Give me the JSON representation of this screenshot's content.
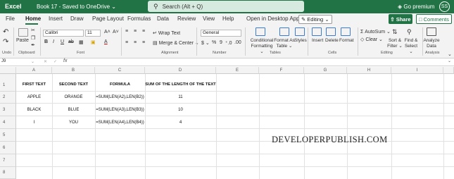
{
  "title": {
    "app": "Excel",
    "document": "Book 17 - Saved to OneDrive ⌄",
    "search_placeholder": "Search (Alt + Q)",
    "premium": "Go premium",
    "avatar_initials": "SS"
  },
  "menu": {
    "tabs": [
      "File",
      "Home",
      "Insert",
      "Draw",
      "Page Layout",
      "Formulas",
      "Data",
      "Review",
      "View",
      "Help",
      "Open in Desktop App"
    ],
    "editing": "Editing ⌄",
    "share": "Share",
    "comments": "Comments"
  },
  "ribbon": {
    "undo": "Undo",
    "paste": "Paste",
    "clipboard": "Clipboard",
    "font_name": "Calibri",
    "font_size": "11",
    "font_group": "Font",
    "wrap_text": "Wrap Text",
    "merge_center": "Merge & Center ⌄",
    "alignment": "Alignment",
    "number_format": "General",
    "number_group": "Number",
    "conditional_formatting": "Conditional Formatting ⌄",
    "format_as_table": "Format As Table ⌄",
    "styles": "Styles",
    "tables": "Tables",
    "insert": "Insert",
    "delete": "Delete",
    "format": "Format",
    "cells": "Cells",
    "autosum": "AutoSum ⌄",
    "clear": "Clear ⌄",
    "sort_filter": "Sort & Filter ⌄",
    "find_select": "Find & Select ⌄",
    "editing": "Editing",
    "analyze_data": "Analyze Data",
    "analysis": "Analysis"
  },
  "formula_bar": {
    "name_box": "J9",
    "fx": "fx",
    "content": ""
  },
  "columns": [
    "A",
    "B",
    "C",
    "D",
    "E",
    "F",
    "G",
    "H",
    "I"
  ],
  "rows": [
    "1",
    "2",
    "3",
    "4",
    "5",
    "6",
    "7",
    "8"
  ],
  "cells": {
    "A1": "FIRST TEXT",
    "B1": "SECOND TEXT",
    "C1": "FORMULA",
    "D1": "SUM OF THE LENGTH OF THE TEXT",
    "A2": "APPLE",
    "B2": "ORANGE",
    "C2": "=SUM(LEN(A2),LEN(B2))",
    "D2": "11",
    "A3": "BLACK",
    "B3": "BLUE",
    "C3": "=SUM(LEN(A3),LEN(B3))",
    "D3": "10",
    "A4": "I",
    "B4": "YOU",
    "C4": "=SUM(LEN(A4),LEN(B4))",
    "D4": "4"
  },
  "watermark": "DEVELOPERPUBLISH.COM",
  "colors": {
    "excel_green": "#217346"
  }
}
